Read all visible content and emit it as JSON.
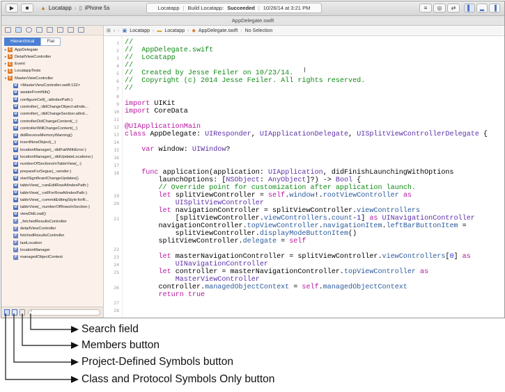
{
  "toolbar": {
    "scheme": "Locatapp",
    "device": "iPhone 5s",
    "status_app": "Locatapp",
    "status_build": "Build Locatapp:",
    "status_result": "Succeeded",
    "status_date": "10/26/14 at 3:21 PM"
  },
  "window_title": "AppDelegate.swift",
  "navigator": {
    "segments": [
      "Hierarchical",
      "Flat"
    ],
    "items": [
      {
        "label": "AppDelegate",
        "badge": "C",
        "indent": 0,
        "tri": "▸"
      },
      {
        "label": "DetailViewController",
        "badge": "C",
        "indent": 0,
        "tri": "▸"
      },
      {
        "label": "Event",
        "badge": "C",
        "indent": 0,
        "tri": "▸"
      },
      {
        "label": "LocatappTests",
        "badge": "C",
        "indent": 0,
        "tri": "▸"
      },
      {
        "label": "MasterViewController",
        "badge": "C",
        "indent": 0,
        "tri": "▾"
      },
      {
        "label": "<MasterViewController.swift:132>",
        "badge": "M",
        "indent": 1,
        "tri": ""
      },
      {
        "label": "awakeFromNib()",
        "badge": "M",
        "indent": 1,
        "tri": ""
      },
      {
        "label": "configureCell(_:atIndexPath:)",
        "badge": "M",
        "indent": 1,
        "tri": ""
      },
      {
        "label": "controller(_:didChangeObject:atInde...",
        "badge": "M",
        "indent": 1,
        "tri": ""
      },
      {
        "label": "controller(_:didChangeSection:atInd...",
        "badge": "M",
        "indent": 1,
        "tri": ""
      },
      {
        "label": "controllerDidChangeContent(_:)",
        "badge": "M",
        "indent": 1,
        "tri": ""
      },
      {
        "label": "controllerWillChangeContent(_:)",
        "badge": "M",
        "indent": 1,
        "tri": ""
      },
      {
        "label": "didReceiveMemoryWarning()",
        "badge": "M",
        "indent": 1,
        "tri": ""
      },
      {
        "label": "insertNewObject(_:)",
        "badge": "M",
        "indent": 1,
        "tri": ""
      },
      {
        "label": "locationManager(_:didFailWithError:)",
        "badge": "M",
        "indent": 1,
        "tri": ""
      },
      {
        "label": "locationManager(_:didUpdateLocations:)",
        "badge": "M",
        "indent": 1,
        "tri": ""
      },
      {
        "label": "numberOfSectionsInTableView(_:)",
        "badge": "M",
        "indent": 1,
        "tri": ""
      },
      {
        "label": "prepareForSegue(_:sender:)",
        "badge": "M",
        "indent": 1,
        "tri": ""
      },
      {
        "label": "startSignificantChangeUpdates()",
        "badge": "M",
        "indent": 1,
        "tri": ""
      },
      {
        "label": "tableView(_:canEditRowAtIndexPath:)",
        "badge": "M",
        "indent": 1,
        "tri": ""
      },
      {
        "label": "tableView(_:cellForRowAtIndexPath:)",
        "badge": "M",
        "indent": 1,
        "tri": ""
      },
      {
        "label": "tableView(_:commitEditingStyle:forR...",
        "badge": "M",
        "indent": 1,
        "tri": ""
      },
      {
        "label": "tableView(_:numberOfRowsInSection:)",
        "badge": "M",
        "indent": 1,
        "tri": ""
      },
      {
        "label": "viewDidLoad()",
        "badge": "M",
        "indent": 1,
        "tri": ""
      },
      {
        "label": "_fetchedResultsController",
        "badge": "P",
        "indent": 1,
        "tri": ""
      },
      {
        "label": "detailViewController",
        "badge": "P",
        "indent": 1,
        "tri": ""
      },
      {
        "label": "fetchedResultsController",
        "badge": "P",
        "indent": 1,
        "tri": ""
      },
      {
        "label": "lastLocation",
        "badge": "P",
        "indent": 1,
        "tri": ""
      },
      {
        "label": "locationManager",
        "badge": "P",
        "indent": 1,
        "tri": ""
      },
      {
        "label": "managedObjectContext",
        "badge": "P",
        "indent": 1,
        "tri": ""
      }
    ]
  },
  "jumpbar": {
    "crumbs": [
      "Locatapp",
      "Locatapp",
      "AppDelegate.swift",
      "No Selection"
    ]
  },
  "code": {
    "gutter_numbers": [
      {
        "n": "1",
        "line": 0
      },
      {
        "n": "2",
        "line": 1
      },
      {
        "n": "3",
        "line": 2
      },
      {
        "n": "4",
        "line": 3
      },
      {
        "n": "5",
        "line": 4
      },
      {
        "n": "6",
        "line": 5
      },
      {
        "n": "7",
        "line": 6
      },
      {
        "n": "8",
        "line": 7
      },
      {
        "n": "9",
        "line": 8
      },
      {
        "n": "10",
        "line": 9
      },
      {
        "n": "11",
        "line": 10
      },
      {
        "n": "12",
        "line": 11
      },
      {
        "n": "13",
        "line": 12
      },
      {
        "n": "14",
        "line": 13
      },
      {
        "n": "15",
        "line": 14
      },
      {
        "n": "16",
        "line": 15
      },
      {
        "n": "17",
        "line": 16
      },
      {
        "n": "18",
        "line": 17
      },
      {
        "n": "19",
        "line": 20
      },
      {
        "n": "20",
        "line": 21
      },
      {
        "n": "21",
        "line": 23
      },
      {
        "n": "22",
        "line": 27
      },
      {
        "n": "23",
        "line": 28
      },
      {
        "n": "24",
        "line": 29
      },
      {
        "n": "25",
        "line": 30
      },
      {
        "n": "26",
        "line": 32
      },
      {
        "n": "27",
        "line": 34
      },
      {
        "n": "28",
        "line": 35
      }
    ],
    "lines": [
      [
        {
          "t": "//",
          "c": "cm"
        }
      ],
      [
        {
          "t": "//  AppDelegate.swift",
          "c": "cm"
        }
      ],
      [
        {
          "t": "//  Locatapp",
          "c": "cm"
        }
      ],
      [
        {
          "t": "//",
          "c": "cm"
        }
      ],
      [
        {
          "t": "//  Created by Jesse Feiler on 10/23/14.",
          "c": "cm"
        }
      ],
      [
        {
          "t": "//  Copyright (c) 2014 Jesse Feiler. All rights reserved.",
          "c": "cm"
        }
      ],
      [
        {
          "t": "//",
          "c": "cm"
        }
      ],
      [],
      [
        {
          "t": "import",
          "c": "kw"
        },
        {
          "t": " UIKit",
          "c": ""
        }
      ],
      [
        {
          "t": "import",
          "c": "kw"
        },
        {
          "t": " CoreData",
          "c": ""
        }
      ],
      [],
      [
        {
          "t": "@UIApplicationMain",
          "c": "kw"
        }
      ],
      [
        {
          "t": "class",
          "c": "kw"
        },
        {
          "t": " AppDelegate: ",
          "c": ""
        },
        {
          "t": "UIResponder",
          "c": "ty"
        },
        {
          "t": ", ",
          "c": ""
        },
        {
          "t": "UIApplicationDelegate",
          "c": "ty"
        },
        {
          "t": ", ",
          "c": ""
        },
        {
          "t": "UISplitViewControllerDelegate",
          "c": "ty"
        },
        {
          "t": " {",
          "c": ""
        }
      ],
      [],
      [
        {
          "t": "    ",
          "c": ""
        },
        {
          "t": "var",
          "c": "kw"
        },
        {
          "t": " window: ",
          "c": ""
        },
        {
          "t": "UIWindow",
          "c": "ty"
        },
        {
          "t": "?",
          "c": ""
        }
      ],
      [],
      [],
      [
        {
          "t": "    ",
          "c": ""
        },
        {
          "t": "func",
          "c": "kw"
        },
        {
          "t": " application(application: ",
          "c": ""
        },
        {
          "t": "UIApplication",
          "c": "ty"
        },
        {
          "t": ", didFinishLaunchingWithOptions",
          "c": ""
        }
      ],
      [
        {
          "t": "        launchOptions: [",
          "c": ""
        },
        {
          "t": "NSObject",
          "c": "ty"
        },
        {
          "t": ": ",
          "c": ""
        },
        {
          "t": "AnyObject",
          "c": "ty"
        },
        {
          "t": "]?) -> ",
          "c": ""
        },
        {
          "t": "Bool",
          "c": "ty"
        },
        {
          "t": " {",
          "c": ""
        }
      ],
      [
        {
          "t": "        ",
          "c": ""
        },
        {
          "t": "// Override point for customization after application launch.",
          "c": "cm"
        }
      ],
      [
        {
          "t": "        ",
          "c": ""
        },
        {
          "t": "let",
          "c": "kw"
        },
        {
          "t": " splitViewController = ",
          "c": ""
        },
        {
          "t": "self",
          "c": "kw"
        },
        {
          "t": ".",
          "c": ""
        },
        {
          "t": "window",
          "c": "mt"
        },
        {
          "t": "!.",
          "c": ""
        },
        {
          "t": "rootViewController",
          "c": "mt"
        },
        {
          "t": " as",
          "c": "kw"
        }
      ],
      [
        {
          "t": "            ",
          "c": ""
        },
        {
          "t": "UISplitViewController",
          "c": "ty"
        }
      ],
      [
        {
          "t": "        ",
          "c": ""
        },
        {
          "t": "let",
          "c": "kw"
        },
        {
          "t": " navigationController = splitViewController.",
          "c": ""
        },
        {
          "t": "viewControllers",
          "c": "mt"
        }
      ],
      [
        {
          "t": "            [splitViewController.",
          "c": ""
        },
        {
          "t": "viewControllers",
          "c": "mt"
        },
        {
          "t": ".",
          "c": ""
        },
        {
          "t": "count",
          "c": "mt"
        },
        {
          "t": "-",
          "c": ""
        },
        {
          "t": "1",
          "c": "nm"
        },
        {
          "t": "] ",
          "c": ""
        },
        {
          "t": "as",
          "c": "kw"
        },
        {
          "t": " ",
          "c": ""
        },
        {
          "t": "UINavigationController",
          "c": "ty"
        }
      ],
      [
        {
          "t": "        navigationController.",
          "c": ""
        },
        {
          "t": "topViewController",
          "c": "mt"
        },
        {
          "t": ".",
          "c": ""
        },
        {
          "t": "navigationItem",
          "c": "mt"
        },
        {
          "t": ".",
          "c": ""
        },
        {
          "t": "leftBarButtonItem",
          "c": "mt"
        },
        {
          "t": " =",
          "c": ""
        }
      ],
      [
        {
          "t": "            splitViewController.",
          "c": ""
        },
        {
          "t": "displayModeButtonItem",
          "c": "mt"
        },
        {
          "t": "()",
          "c": ""
        }
      ],
      [
        {
          "t": "        splitViewController.",
          "c": ""
        },
        {
          "t": "delegate",
          "c": "mt"
        },
        {
          "t": " = ",
          "c": ""
        },
        {
          "t": "self",
          "c": "kw"
        }
      ],
      [],
      [
        {
          "t": "        ",
          "c": ""
        },
        {
          "t": "let",
          "c": "kw"
        },
        {
          "t": " masterNavigationController = splitViewController.",
          "c": ""
        },
        {
          "t": "viewControllers",
          "c": "mt"
        },
        {
          "t": "[",
          "c": ""
        },
        {
          "t": "0",
          "c": "nm"
        },
        {
          "t": "] ",
          "c": ""
        },
        {
          "t": "as",
          "c": "kw"
        }
      ],
      [
        {
          "t": "            ",
          "c": ""
        },
        {
          "t": "UINavigationController",
          "c": "ty"
        }
      ],
      [
        {
          "t": "        ",
          "c": ""
        },
        {
          "t": "let",
          "c": "kw"
        },
        {
          "t": " controller = masterNavigationController.",
          "c": ""
        },
        {
          "t": "topViewController",
          "c": "mt"
        },
        {
          "t": " as",
          "c": "kw"
        }
      ],
      [
        {
          "t": "            ",
          "c": ""
        },
        {
          "t": "MasterViewController",
          "c": "ty"
        }
      ],
      [
        {
          "t": "        controller.",
          "c": ""
        },
        {
          "t": "managedObjectContext",
          "c": "mt"
        },
        {
          "t": " = ",
          "c": ""
        },
        {
          "t": "self",
          "c": "kw"
        },
        {
          "t": ".",
          "c": ""
        },
        {
          "t": "managedObjectContext",
          "c": "mt"
        }
      ],
      [
        {
          "t": "        ",
          "c": ""
        },
        {
          "t": "return",
          "c": "kw"
        },
        {
          "t": " ",
          "c": ""
        },
        {
          "t": "true",
          "c": "kw"
        }
      ]
    ]
  },
  "callouts": {
    "search_field": "Search field",
    "members_button": "Members button",
    "project_symbols": "Project-Defined Symbols button",
    "class_protocol": "Class and Protocol Symbols Only button"
  },
  "colors": {
    "class_badge": "#e07b2a",
    "method_badge": "#4a6fc4",
    "property_badge": "#6b84c9",
    "selection": "#4a7fd4"
  }
}
